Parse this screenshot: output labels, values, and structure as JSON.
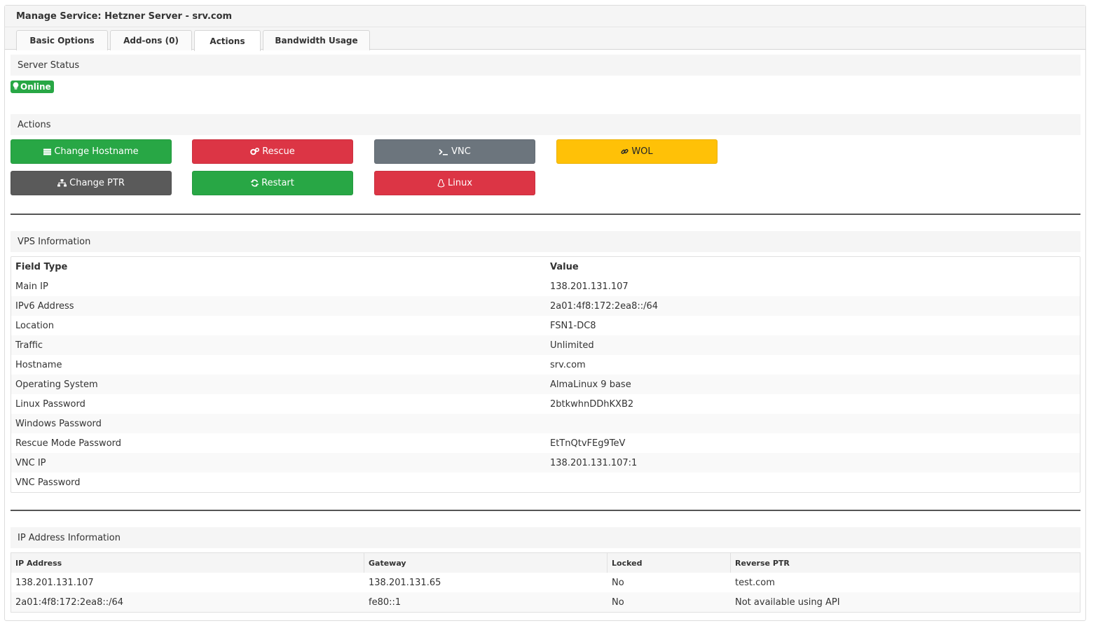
{
  "header": {
    "title": "Manage Service: Hetzner Server - srv.com"
  },
  "tabs": [
    {
      "label": "Basic Options"
    },
    {
      "label": "Add-ons (0)"
    },
    {
      "label": "Actions"
    },
    {
      "label": "Bandwidth Usage"
    }
  ],
  "active_tab": "Actions",
  "server_status": {
    "title": "Server Status",
    "badge": "Online",
    "badge_color": "#28a745",
    "badge_icon": "lightbulb-icon"
  },
  "actions": {
    "title": "Actions",
    "buttons": [
      {
        "label": "Change Hostname",
        "icon": "server-icon",
        "color": "#28a745"
      },
      {
        "label": "Rescue",
        "icon": "gears-icon",
        "color": "#dc3545"
      },
      {
        "label": "VNC",
        "icon": "terminal-icon",
        "color": "#6c757d"
      },
      {
        "label": "WOL",
        "icon": "link-icon",
        "color": "#ffc107"
      },
      {
        "label": "Change PTR",
        "icon": "sitemap-icon",
        "color": "#5a5a5a"
      },
      {
        "label": "Restart",
        "icon": "refresh-icon",
        "color": "#28a745"
      },
      {
        "label": "Linux",
        "icon": "linux-icon",
        "color": "#dc3545"
      }
    ]
  },
  "vps_info": {
    "title": "VPS Information",
    "headers": [
      "Field Type",
      "Value"
    ],
    "rows": [
      [
        "Main IP",
        "138.201.131.107"
      ],
      [
        "IPv6 Address",
        "2a01:4f8:172:2ea8::/64"
      ],
      [
        "Location",
        "FSN1-DC8"
      ],
      [
        "Traffic",
        "Unlimited"
      ],
      [
        "Hostname",
        "srv.com"
      ],
      [
        "Operating System",
        "AlmaLinux 9 base"
      ],
      [
        "Linux Password",
        "2btkwhnDDhKXB2"
      ],
      [
        "Windows Password",
        ""
      ],
      [
        "Rescue Mode Password",
        "EtTnQtvFEg9TeV"
      ],
      [
        "VNC IP",
        "138.201.131.107:1"
      ],
      [
        "VNC Password",
        ""
      ]
    ]
  },
  "ip_info": {
    "title": "IP Address Information",
    "headers": [
      "IP Address",
      "Gateway",
      "Locked",
      "Reverse PTR"
    ],
    "rows": [
      [
        "138.201.131.107",
        "138.201.131.65",
        "No",
        "test.com"
      ],
      [
        "2a01:4f8:172:2ea8::/64",
        "fe80::1",
        "No",
        "Not available using API"
      ]
    ]
  }
}
